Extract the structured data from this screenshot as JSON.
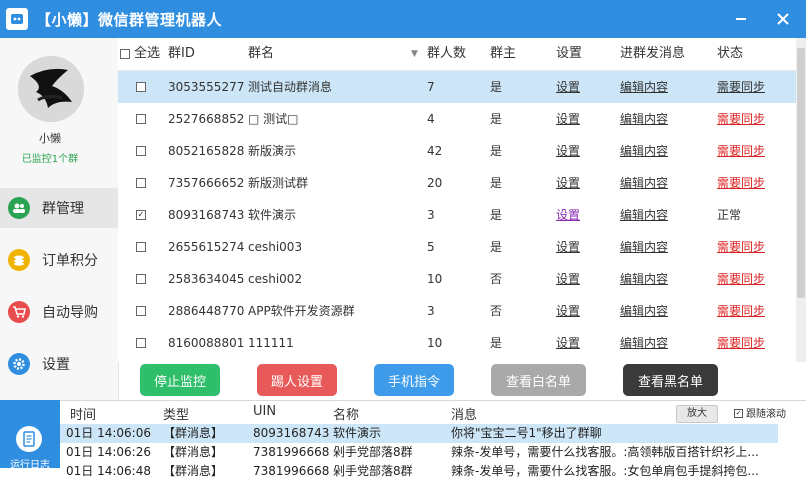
{
  "window": {
    "title": "【小懒】微信群管理机器人",
    "accent": "#2f8ee0"
  },
  "user": {
    "name": "小懒",
    "status": "已监控1个群"
  },
  "nav": [
    {
      "label": "群管理",
      "icon": "group-icon",
      "color": "#2aa452",
      "active": true
    },
    {
      "label": "订单积分",
      "icon": "coin-icon",
      "color": "#f0b400"
    },
    {
      "label": "自动导购",
      "icon": "cart-icon",
      "color": "#e84c4c"
    },
    {
      "label": "设置",
      "icon": "gear-icon",
      "color": "#2f8ee0"
    }
  ],
  "table": {
    "headers": {
      "select_all": "全选",
      "id": "群ID",
      "name": "群名",
      "count": "群人数",
      "owner": "群主",
      "settings": "设置",
      "message": "进群发消息",
      "status": "状态"
    },
    "rows": [
      {
        "checked": false,
        "id": "3053555277",
        "name": "测试自动群消息",
        "count": "7",
        "owner": "是",
        "settings": "设置",
        "message": "编辑内容",
        "status": "需要同步",
        "status_style": "dark",
        "selected": true
      },
      {
        "checked": false,
        "id": "2527668852",
        "name": "□ 测试□",
        "count": "4",
        "owner": "是",
        "settings": "设置",
        "message": "编辑内容",
        "status": "需要同步",
        "status_style": "red"
      },
      {
        "checked": false,
        "id": "8052165828",
        "name": "新版演示",
        "count": "42",
        "owner": "是",
        "settings": "设置",
        "message": "编辑内容",
        "status": "需要同步",
        "status_style": "red"
      },
      {
        "checked": false,
        "id": "7357666652",
        "name": "新版测试群",
        "count": "20",
        "owner": "是",
        "settings": "设置",
        "message": "编辑内容",
        "status": "需要同步",
        "status_style": "red"
      },
      {
        "checked": true,
        "id": "8093168743",
        "name": "软件演示",
        "count": "3",
        "owner": "是",
        "settings": "设置",
        "message": "编辑内容",
        "status": "正常",
        "status_style": "plain",
        "visited": true
      },
      {
        "checked": false,
        "id": "2655615274",
        "name": "ceshi003",
        "count": "5",
        "owner": "是",
        "settings": "设置",
        "message": "编辑内容",
        "status": "需要同步",
        "status_style": "red"
      },
      {
        "checked": false,
        "id": "2583634045",
        "name": "ceshi002",
        "count": "10",
        "owner": "否",
        "settings": "设置",
        "message": "编辑内容",
        "status": "需要同步",
        "status_style": "red"
      },
      {
        "checked": false,
        "id": "2886448770",
        "name": "APP软件开发资源群",
        "count": "3",
        "owner": "否",
        "settings": "设置",
        "message": "编辑内容",
        "status": "需要同步",
        "status_style": "red"
      },
      {
        "checked": false,
        "id": "8160088801",
        "name": "111111",
        "count": "10",
        "owner": "是",
        "settings": "设置",
        "message": "编辑内容",
        "status": "需要同步",
        "status_style": "red"
      }
    ]
  },
  "buttons": [
    {
      "label": "停止监控",
      "color": "#2fbf6a"
    },
    {
      "label": "踢人设置",
      "color": "#e85a5a"
    },
    {
      "label": "手机指令",
      "color": "#3d9be9"
    },
    {
      "label": "查看白名单",
      "color": "#a9a9a9"
    },
    {
      "label": "查看黑名单",
      "color": "#3a3a3a"
    }
  ],
  "log": {
    "side_label": "运行日志",
    "headers": {
      "time": "时间",
      "type": "类型",
      "uin": "UIN",
      "name": "名称",
      "message": "消息"
    },
    "zoom_label": "放大",
    "follow_label": "跟随滚动",
    "follow_checked": true,
    "rows": [
      {
        "time": "01日 14:06:06",
        "type": "【群消息】",
        "uin": "8093168743",
        "name": "软件演示",
        "message": "你将\"宝宝二号1\"移出了群聊",
        "selected": true
      },
      {
        "time": "01日 14:06:26",
        "type": "【群消息】",
        "uin": "7381996668",
        "name": "剁手党部落8群",
        "message": "辣条-发单号，需要什么找客服。:高领韩版百搭针织衫上..."
      },
      {
        "time": "01日 14:06:48",
        "type": "【群消息】",
        "uin": "7381996668",
        "name": "剁手党部落8群",
        "message": "辣条-发单号，需要什么找客服。:女包单肩包手提斜挎包..."
      }
    ]
  }
}
